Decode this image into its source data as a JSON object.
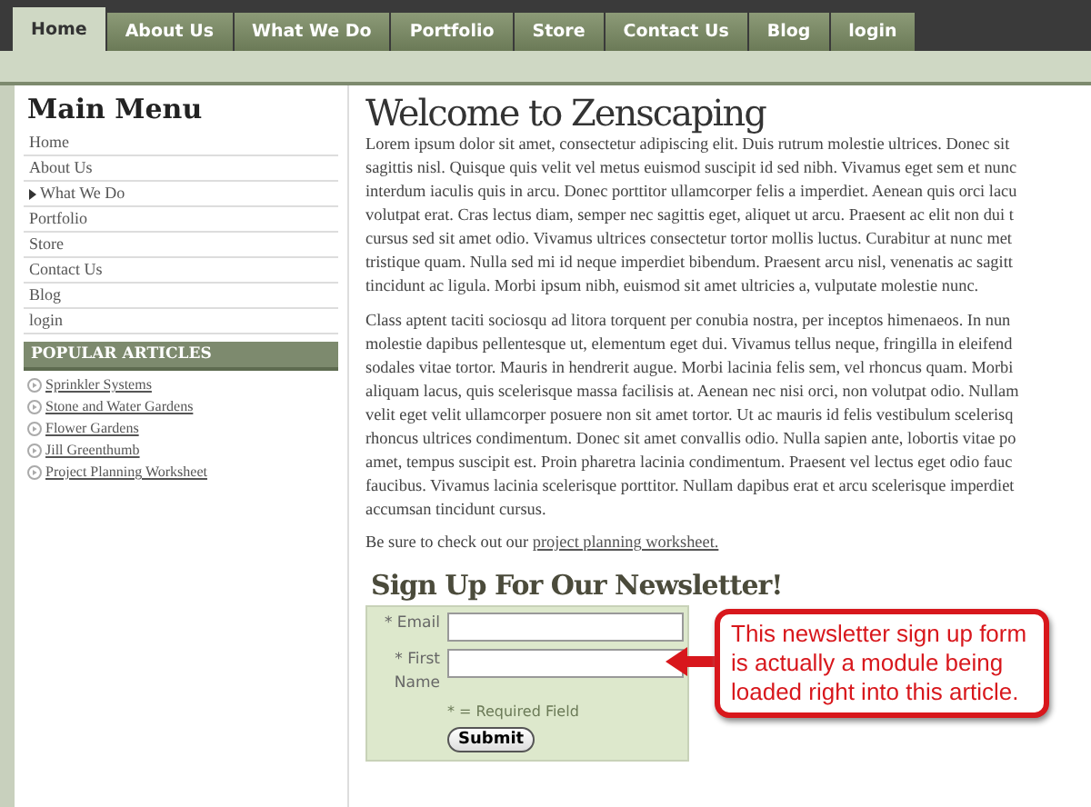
{
  "tabs": [
    {
      "label": "Home",
      "selected": true
    },
    {
      "label": "About Us",
      "selected": false
    },
    {
      "label": "What We Do",
      "selected": false
    },
    {
      "label": "Portfolio",
      "selected": false
    },
    {
      "label": "Store",
      "selected": false
    },
    {
      "label": "Contact Us",
      "selected": false
    },
    {
      "label": "Blog",
      "selected": false
    },
    {
      "label": "login",
      "selected": false
    }
  ],
  "sidebar": {
    "title": "Main Menu",
    "menu": [
      {
        "label": "Home",
        "has_submenu": false
      },
      {
        "label": "About Us",
        "has_submenu": false
      },
      {
        "label": "What We Do",
        "has_submenu": true
      },
      {
        "label": "Portfolio",
        "has_submenu": false
      },
      {
        "label": "Store",
        "has_submenu": false
      },
      {
        "label": "Contact Us",
        "has_submenu": false
      },
      {
        "label": "Blog",
        "has_submenu": false
      },
      {
        "label": "login",
        "has_submenu": false
      }
    ],
    "popular_title": "POPULAR ARTICLES",
    "articles": [
      "Sprinkler Systems",
      "Stone and Water Gardens",
      "Flower Gardens",
      "Jill Greenthumb",
      "Project Planning Worksheet"
    ]
  },
  "article": {
    "title": "Welcome to Zenscaping",
    "paragraphs": [
      [
        "Lorem ipsum dolor sit amet, consectetur adipiscing elit. Duis rutrum molestie ultrices. Donec sit",
        "sagittis nisl. Quisque quis velit vel metus euismod suscipit id sed nibh. Vivamus eget sem et nunc",
        "interdum iaculis quis in arcu. Donec porttitor ullamcorper felis a imperdiet. Aenean quis orci lacu",
        "volutpat erat. Cras lectus diam, semper nec sagittis eget, aliquet ut arcu. Praesent ac elit non dui t",
        "cursus sed sit amet odio. Vivamus ultrices consectetur tortor mollis luctus. Curabitur at nunc met",
        "tristique quam. Nulla sed mi id neque imperdiet bibendum. Praesent arcu nisl, venenatis ac sagitt",
        "tincidunt ac ligula. Morbi ipsum nibh, euismod sit amet ultricies a, vulputate molestie nunc."
      ],
      [
        "Class aptent taciti sociosqu ad litora torquent per conubia nostra, per inceptos himenaeos. In nun",
        "molestie dapibus pellentesque ut, elementum eget dui. Vivamus tellus neque, fringilla in eleifend",
        "sodales vitae tortor. Mauris in hendrerit augue. Morbi lacinia felis sem, vel rhoncus quam. Morbi",
        "aliquam lacus, quis scelerisque massa facilisis at. Aenean nec nisi orci, non volutpat odio. Nullam",
        "velit eget velit ullamcorper posuere non sit amet tortor. Ut ac mauris id felis vestibulum scelerisq",
        "rhoncus ultrices condimentum. Donec sit amet convallis odio. Nulla sapien ante, lobortis vitae po",
        "amet, tempus suscipit est. Proin pharetra lacinia condimentum. Praesent vel lectus eget odio fauc",
        "faucibus. Vivamus lacinia scelerisque porttitor. Nullam dapibus erat et arcu scelerisque imperdiet",
        "accumsan tincidunt cursus."
      ]
    ],
    "closing_text": "Be sure to check out our",
    "closing_link": "project planning worksheet."
  },
  "newsletter": {
    "title": "Sign Up For Our Newsletter!",
    "fields": [
      {
        "marker": "*",
        "label": "Email"
      },
      {
        "marker": "*",
        "label": "First Name"
      }
    ],
    "required_note": "* = Required Field",
    "submit": "Submit"
  },
  "callout": {
    "text": "This newsletter sign up form is actually a module being loaded right into this article."
  }
}
